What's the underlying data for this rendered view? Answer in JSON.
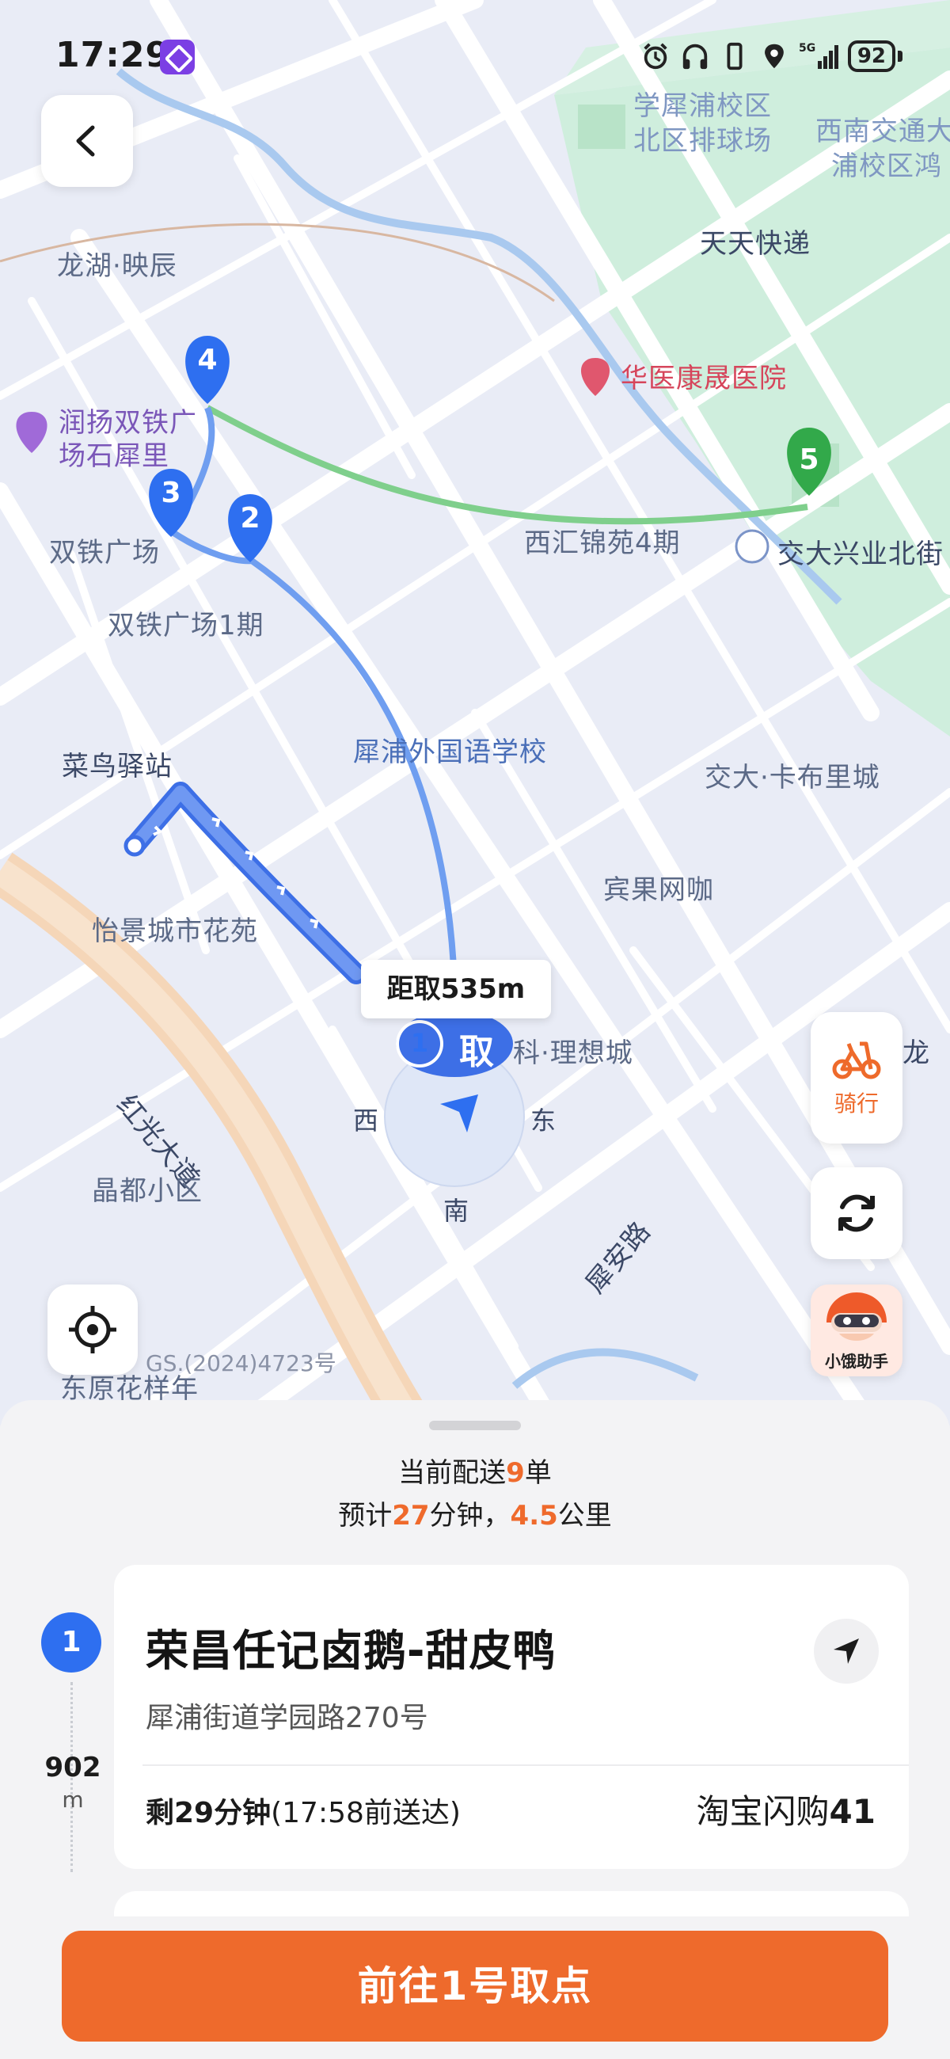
{
  "status_bar": {
    "time": "17:29",
    "battery": "92",
    "network": "5G"
  },
  "map": {
    "labels": {
      "xiwan_campus": "学犀浦校区",
      "volleyball": "北区排球场",
      "swjtu": "西南交通大",
      "swjtu_2": "浦校区鸿",
      "tiantian": "天天快递",
      "longhu": "龙湖·映辰",
      "hospital": "华医康晟医院",
      "runyang_1": "润扬双铁广",
      "runyang_2": "场石犀里",
      "shuangtie": "双铁广场",
      "shuangtie_1": "双铁广场1期",
      "xihui": "西汇锦苑4期",
      "jiaoda_xingye": "交大兴业北街",
      "xipu_school": "犀浦外国语学校",
      "jiaoda_kabuli": "交大·卡布里城",
      "cainiao": "菜鸟驿站",
      "binguo": "宾果网咖",
      "yijing": "怡景城市花苑",
      "hongguang": "红光大道",
      "lixiang": "科·理想城",
      "jingdu": "晶都小区",
      "xian_road": "犀安路",
      "long": "龙",
      "dongyuan": "东原花样年"
    },
    "pins": [
      {
        "number": "1"
      },
      {
        "number": "2"
      },
      {
        "number": "3"
      },
      {
        "number": "4"
      },
      {
        "number": "5"
      }
    ],
    "pickup_badge": "取",
    "callout": "距取535m",
    "compass": {
      "west": "西",
      "east": "东",
      "south": "南"
    },
    "approval_number": "GS.(2024)4723号",
    "colors": {
      "route_blue": "#6f9ef0",
      "route_green": "#7fcf8c",
      "pin_blue": "#2e6ff0",
      "pin_green": "#32a94a",
      "accent": "#ee6a2c"
    }
  },
  "controls": {
    "back_icon": "chevron-left-icon",
    "ride_label": "骑行",
    "assistant_label": "小饿助手"
  },
  "summary": {
    "prefix_orders": "当前配送",
    "orders": "9",
    "suffix_orders": "单",
    "prefix_eta": "预计",
    "minutes": "27",
    "unit_minutes": "分钟，",
    "km": "4.5",
    "unit_km": "公里"
  },
  "stop": {
    "index": "1",
    "distance": "902",
    "distance_unit": "m",
    "name": "荣昌任记卤鹅-甜皮鸭",
    "address": "犀浦街道学园路270号",
    "remaining_bold": "剩29分钟",
    "deadline": "(17:58前送达)",
    "order_source": "淘宝闪购",
    "order_number": "41"
  },
  "cta": {
    "label": "前往1号取点"
  }
}
